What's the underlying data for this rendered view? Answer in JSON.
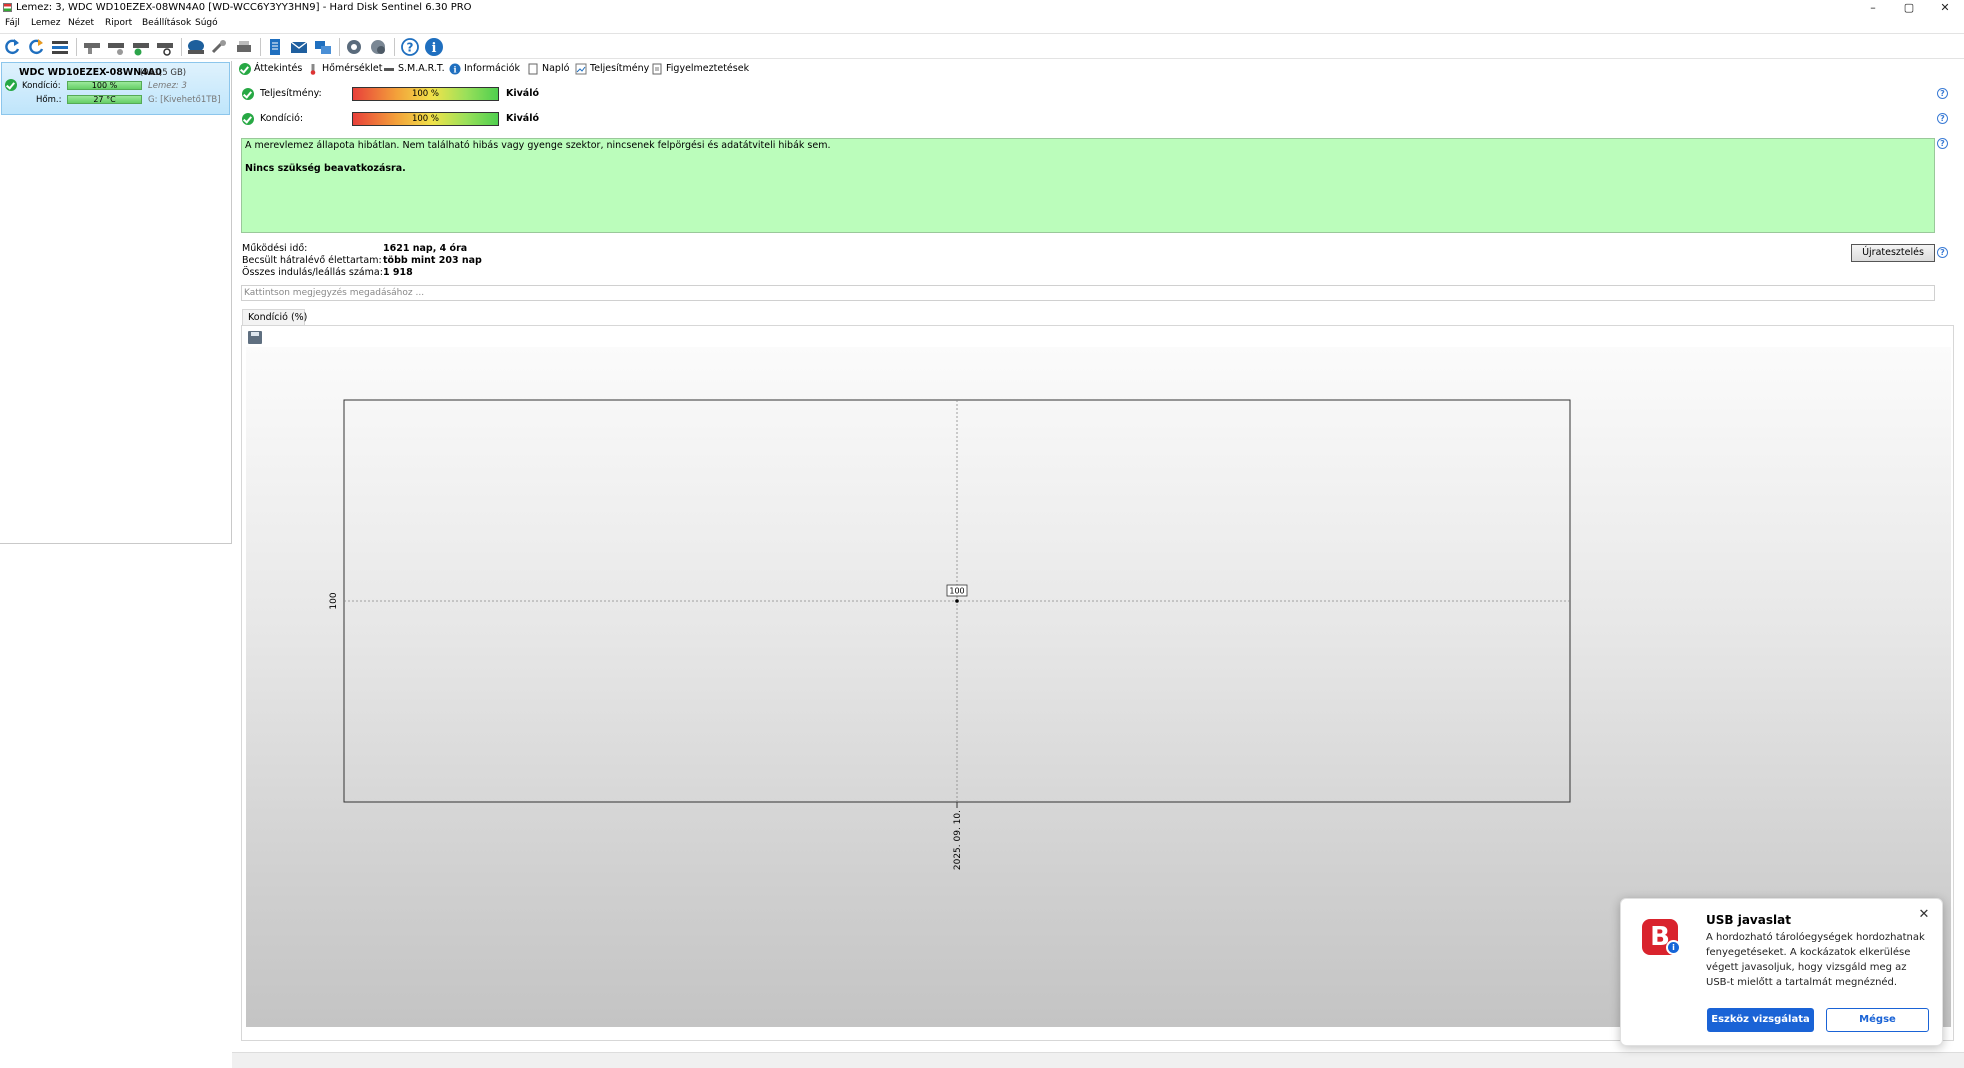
{
  "window": {
    "title": "Lemez: 3, WDC WD10EZEX-08WN4A0 [WD-WCC6Y3YY3HN9]  -  Hard Disk Sentinel 6.30 PRO",
    "minimize": "–",
    "maximize": "▢",
    "close": "✕"
  },
  "menu": [
    "Fájl",
    "Lemez",
    "Nézet",
    "Riport",
    "Beállítások",
    "Súgó"
  ],
  "disk_panel": {
    "name": "WDC WD10EZEX-08WN4A0",
    "size": "(931,5 GB)",
    "health_label": "Kondíció:",
    "health_value": "100 %",
    "disk_index": "Lemez: 3",
    "temp_label": "Hőm.:",
    "temp_value": "27 °C",
    "volume": "G: [Kivehető1TB]"
  },
  "tabs": [
    "Áttekintés",
    "Hőmérséklet",
    "S.M.A.R.T.",
    "Információk",
    "Napló",
    "Teljesítmény",
    "Figyelmeztetések"
  ],
  "performance": {
    "label": "Teljesítmény:",
    "value": "100 %",
    "rating": "Kiváló",
    "level": 100
  },
  "health": {
    "label": "Kondíció:",
    "value": "100 %",
    "rating": "Kiváló",
    "level": 100
  },
  "status": {
    "message": "A merevlemez állapota hibátlan. Nem található hibás vagy gyenge szektor, nincsenek felpörgési és adatátviteli hibák sem.",
    "advice": "Nincs szükség beavatkozásra."
  },
  "info": {
    "uptime_label": "Működési idő:",
    "uptime_value": "1621 nap, 4 óra",
    "lifetime_label": "Becsült hátralévő élettartam:",
    "lifetime_value": "több mint 203 nap",
    "starts_label": "Összes indulás/leállás száma:",
    "starts_value": "1 918"
  },
  "retest_button": "Újratesztelés",
  "help": "?",
  "note_placeholder": "Kattintson megjegyzés megadásához ...",
  "chart_tab": "Kondíció  (%)",
  "chart_data": {
    "type": "line",
    "x": [
      "2025. 09. 10."
    ],
    "series": [
      {
        "values": [
          100
        ]
      }
    ],
    "x_tick_labels": [
      "2025. 09. 10."
    ],
    "y_tick_labels": [
      "100"
    ],
    "data_labels": [
      "100"
    ],
    "xlabel": "",
    "ylabel": "",
    "ylim": [
      99,
      101
    ],
    "grid": true
  },
  "toast": {
    "title": "USB javaslat",
    "body": "A hordozható tárolóegységek hordozhatnak fenyegetéseket. A kockázatok elkerülése végett javasoljuk, hogy vizsgáld meg az USB-t mielőtt a tartalmát megnéznéd.",
    "primary": "Eszköz vizsgálata",
    "secondary": "Mégse",
    "logo_letter": "B",
    "badge": "i",
    "close": "✕"
  }
}
